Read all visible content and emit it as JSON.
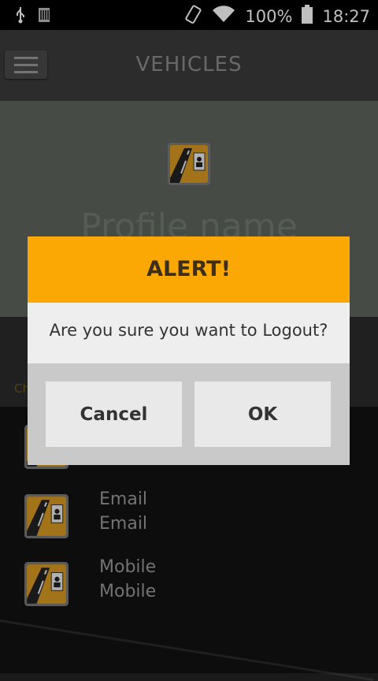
{
  "status_bar": {
    "battery": "100%",
    "time": "18:27"
  },
  "app_bar": {
    "title": "VEHICLES"
  },
  "profile": {
    "name": "Profile name"
  },
  "band": {
    "text": "Ch"
  },
  "list": [
    {
      "line1": "Email",
      "line2": "Email"
    },
    {
      "line1": "Mobile",
      "line2": "Mobile"
    }
  ],
  "dialog": {
    "title": "ALERT!",
    "message": "Are you sure you want to Logout?",
    "cancel_label": "Cancel",
    "ok_label": "OK"
  },
  "colors": {
    "accent": "#fba804",
    "app_bar": "#3b3b3b"
  },
  "icons": [
    "usb-icon",
    "sim-icon",
    "vibrate-icon",
    "wifi-icon",
    "battery-icon",
    "menu-icon",
    "road-logo-icon"
  ]
}
